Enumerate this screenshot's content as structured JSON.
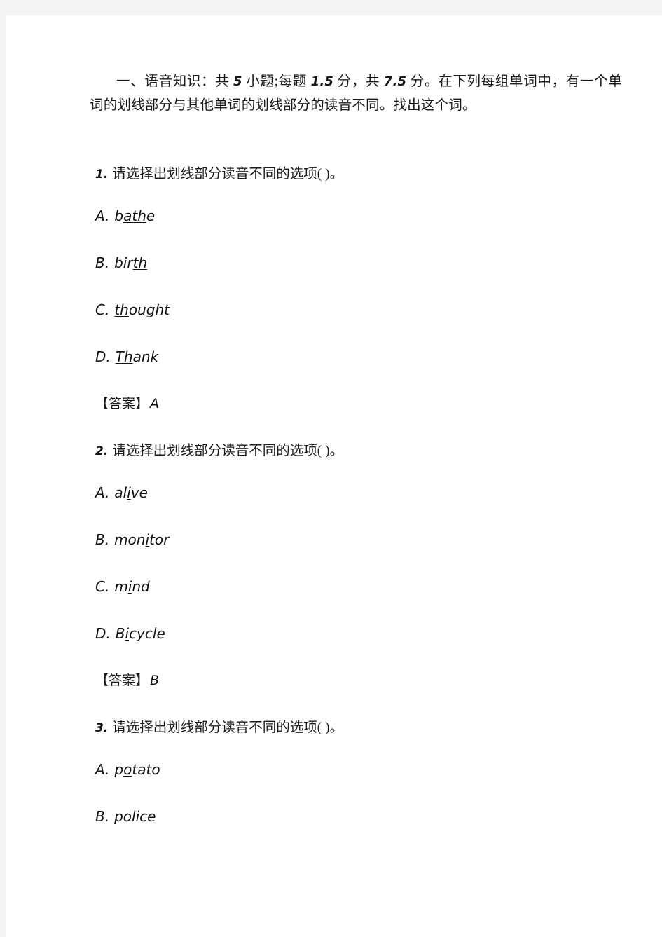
{
  "document": {
    "section_heading": {
      "prefix": "一、语音知识：共 ",
      "count": "5",
      "mid1": " 小题;每题 ",
      "per_item_points": "1.5",
      "mid2": " 分，共 ",
      "total_points": "7.5",
      "suffix": " 分。在下列每组单词中，有一个单词的划线部分与其他单词的划线部分的读音不同。找出这个词。"
    },
    "answer_label": "【答案】",
    "questions": [
      {
        "number": "1.",
        "stem": "请选择出划线部分读音不同的选项(  )。",
        "options": [
          {
            "letter": "A.",
            "pre": "b",
            "underlined": "ath",
            "post": "e",
            "full": "bathe"
          },
          {
            "letter": "B.",
            "pre": "bir",
            "underlined": "th",
            "post": "",
            "full": "birth"
          },
          {
            "letter": "C.",
            "pre": "",
            "underlined": "th",
            "post": "ought",
            "full": "thought"
          },
          {
            "letter": "D.",
            "pre": "",
            "underlined": "Th",
            "post": "ank",
            "full": "Thank"
          }
        ],
        "answer": "A"
      },
      {
        "number": "2.",
        "stem": "请选择出划线部分读音不同的选项(  )。",
        "options": [
          {
            "letter": "A.",
            "pre": "al",
            "underlined": "i",
            "post": "ve",
            "full": "alive"
          },
          {
            "letter": "B.",
            "pre": "mon",
            "underlined": "i",
            "post": "tor",
            "full": "monitor"
          },
          {
            "letter": "C.",
            "pre": "m",
            "underlined": "i",
            "post": "nd",
            "full": "mind"
          },
          {
            "letter": "D.",
            "pre": "B",
            "underlined": "i",
            "post": "cycle",
            "full": "Bicycle"
          }
        ],
        "answer": "B"
      },
      {
        "number": "3.",
        "stem": "请选择出划线部分读音不同的选项(  )。",
        "options": [
          {
            "letter": "A.",
            "pre": "p",
            "underlined": "o",
            "post": "tato",
            "full": "potato"
          },
          {
            "letter": "B.",
            "pre": "p",
            "underlined": "o",
            "post": "lice",
            "full": "police"
          }
        ],
        "answer": ""
      }
    ]
  }
}
